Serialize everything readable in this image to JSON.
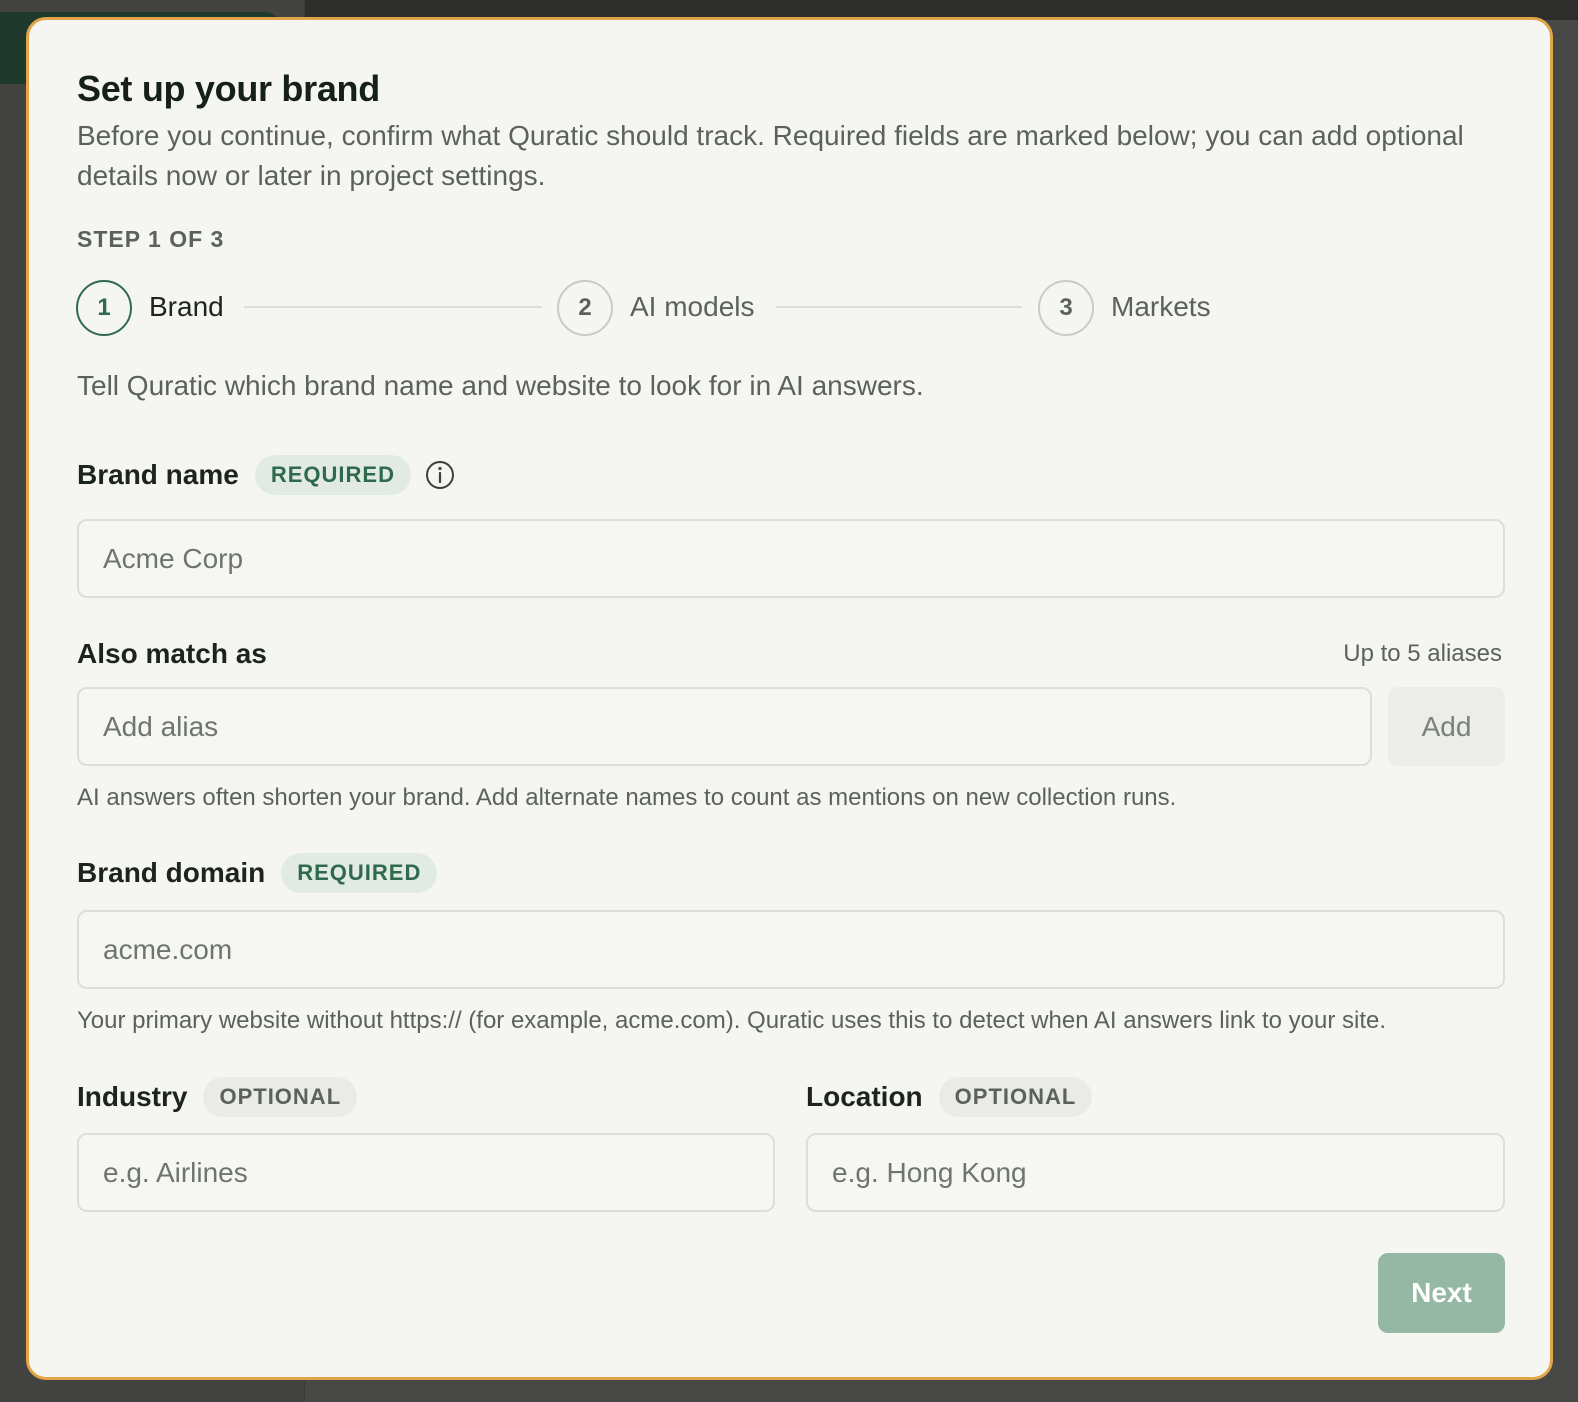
{
  "modal": {
    "title": "Set up your brand",
    "subtitle": "Before you continue, confirm what Quratic should track. Required fields are marked below; you can add optional details now or later in project settings.",
    "step_indicator": "STEP 1 OF 3",
    "steps": [
      {
        "number": "1",
        "label": "Brand",
        "active": true
      },
      {
        "number": "2",
        "label": "AI models",
        "active": false
      },
      {
        "number": "3",
        "label": "Markets",
        "active": false
      }
    ],
    "intro": "Tell Quratic which brand name and website to look for in AI answers."
  },
  "form": {
    "brand_name": {
      "label": "Brand name",
      "badge": "REQUIRED",
      "placeholder": "Acme Corp",
      "value": "",
      "icon": "info-icon"
    },
    "aliases": {
      "label": "Also match as",
      "limit_note": "Up to 5 aliases",
      "placeholder": "Add alias",
      "add_label": "Add",
      "help": "AI answers often shorten your brand. Add alternate names to count as mentions on new collection runs."
    },
    "brand_domain": {
      "label": "Brand domain",
      "badge": "REQUIRED",
      "placeholder": "acme.com",
      "help": "Your primary website without https:// (for example, acme.com). Quratic uses this to detect when AI answers link to your site."
    },
    "industry": {
      "label": "Industry",
      "badge": "OPTIONAL",
      "placeholder": "e.g. Airlines"
    },
    "location": {
      "label": "Location",
      "badge": "OPTIONAL",
      "placeholder": "e.g. Hong Kong"
    }
  },
  "footer": {
    "next_label": "Next"
  },
  "colors": {
    "accent": "#2f6a4e",
    "modal_border": "#e3a448",
    "next_disabled": "#95b8a4"
  }
}
